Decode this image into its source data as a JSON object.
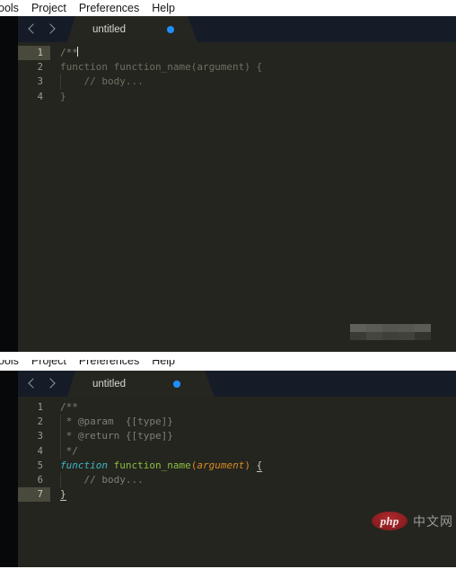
{
  "menu": {
    "items": [
      {
        "label": "ools"
      },
      {
        "label": "Project"
      },
      {
        "label": "Preferences"
      },
      {
        "label": "Help"
      }
    ]
  },
  "colors": {
    "editor_background": "#24251f",
    "tabstrip_background": "#151c28",
    "active_tab_background": "#262621",
    "modified_dot": "#1e90ff",
    "active_line_gutter": "#4a4a3c",
    "keyword": "#3fb6c4",
    "function_name": "#8cbf3f",
    "parameter": "#d98a24",
    "comment": "#7d8072",
    "line_number": "#9d9d8c",
    "watermark_badge": "#b3292c"
  },
  "panel_top": {
    "tab": {
      "title": "untitled",
      "modified": true
    },
    "nav": {
      "back_label": "‹",
      "forward_label": "›"
    },
    "code": {
      "lines": [
        {
          "number": "1",
          "active": true,
          "indent_guide": false,
          "tokens": [
            {
              "text": "/**",
              "type": "comment"
            }
          ],
          "caret": true
        },
        {
          "number": "2",
          "active": false,
          "indent_guide": false,
          "tokens": [
            {
              "text": "function function_name(argument) {",
              "type": "dim"
            }
          ],
          "caret": false
        },
        {
          "number": "3",
          "active": false,
          "indent_guide": true,
          "tokens": [
            {
              "text": "    // body...",
              "type": "dim"
            }
          ],
          "caret": false
        },
        {
          "number": "4",
          "active": false,
          "indent_guide": false,
          "tokens": [
            {
              "text": "}",
              "type": "dim"
            }
          ],
          "caret": false
        }
      ]
    },
    "watermark": {
      "type": "blurred-block",
      "redacted": true
    }
  },
  "panel_bottom": {
    "tab": {
      "title": "untitled",
      "modified": true
    },
    "nav": {
      "back_label": "‹",
      "forward_label": "›"
    },
    "code": {
      "lines": [
        {
          "number": "1",
          "active": false,
          "indent_guide": false,
          "tokens": [
            {
              "text": "/**",
              "type": "comment"
            }
          ],
          "caret": false
        },
        {
          "number": "2",
          "active": false,
          "indent_guide": true,
          "tokens": [
            {
              "text": " * @param  {[type]}",
              "type": "comment"
            }
          ],
          "caret": false
        },
        {
          "number": "3",
          "active": false,
          "indent_guide": true,
          "tokens": [
            {
              "text": " * @return {[type]}",
              "type": "comment"
            }
          ],
          "caret": false
        },
        {
          "number": "4",
          "active": false,
          "indent_guide": true,
          "tokens": [
            {
              "text": " */",
              "type": "comment"
            }
          ],
          "caret": false
        },
        {
          "number": "5",
          "active": false,
          "indent_guide": false,
          "tokens": [
            {
              "text": "function",
              "type": "keyword"
            },
            {
              "text": " ",
              "type": "plain"
            },
            {
              "text": "function_name",
              "type": "function"
            },
            {
              "text": "(",
              "type": "punct"
            },
            {
              "text": "argument",
              "type": "parameter"
            },
            {
              "text": ")",
              "type": "punct"
            },
            {
              "text": " ",
              "type": "plain"
            },
            {
              "text": "{",
              "type": "brace-match"
            }
          ],
          "caret": false
        },
        {
          "number": "6",
          "active": false,
          "indent_guide": true,
          "tokens": [
            {
              "text": "    // body...",
              "type": "comment"
            }
          ],
          "caret": false
        },
        {
          "number": "7",
          "active": true,
          "indent_guide": false,
          "tokens": [
            {
              "text": "}",
              "type": "brace-match"
            }
          ],
          "caret": false
        }
      ]
    },
    "watermark": {
      "type": "php-logo",
      "badge_text": "php",
      "site_text": "中文网"
    }
  }
}
